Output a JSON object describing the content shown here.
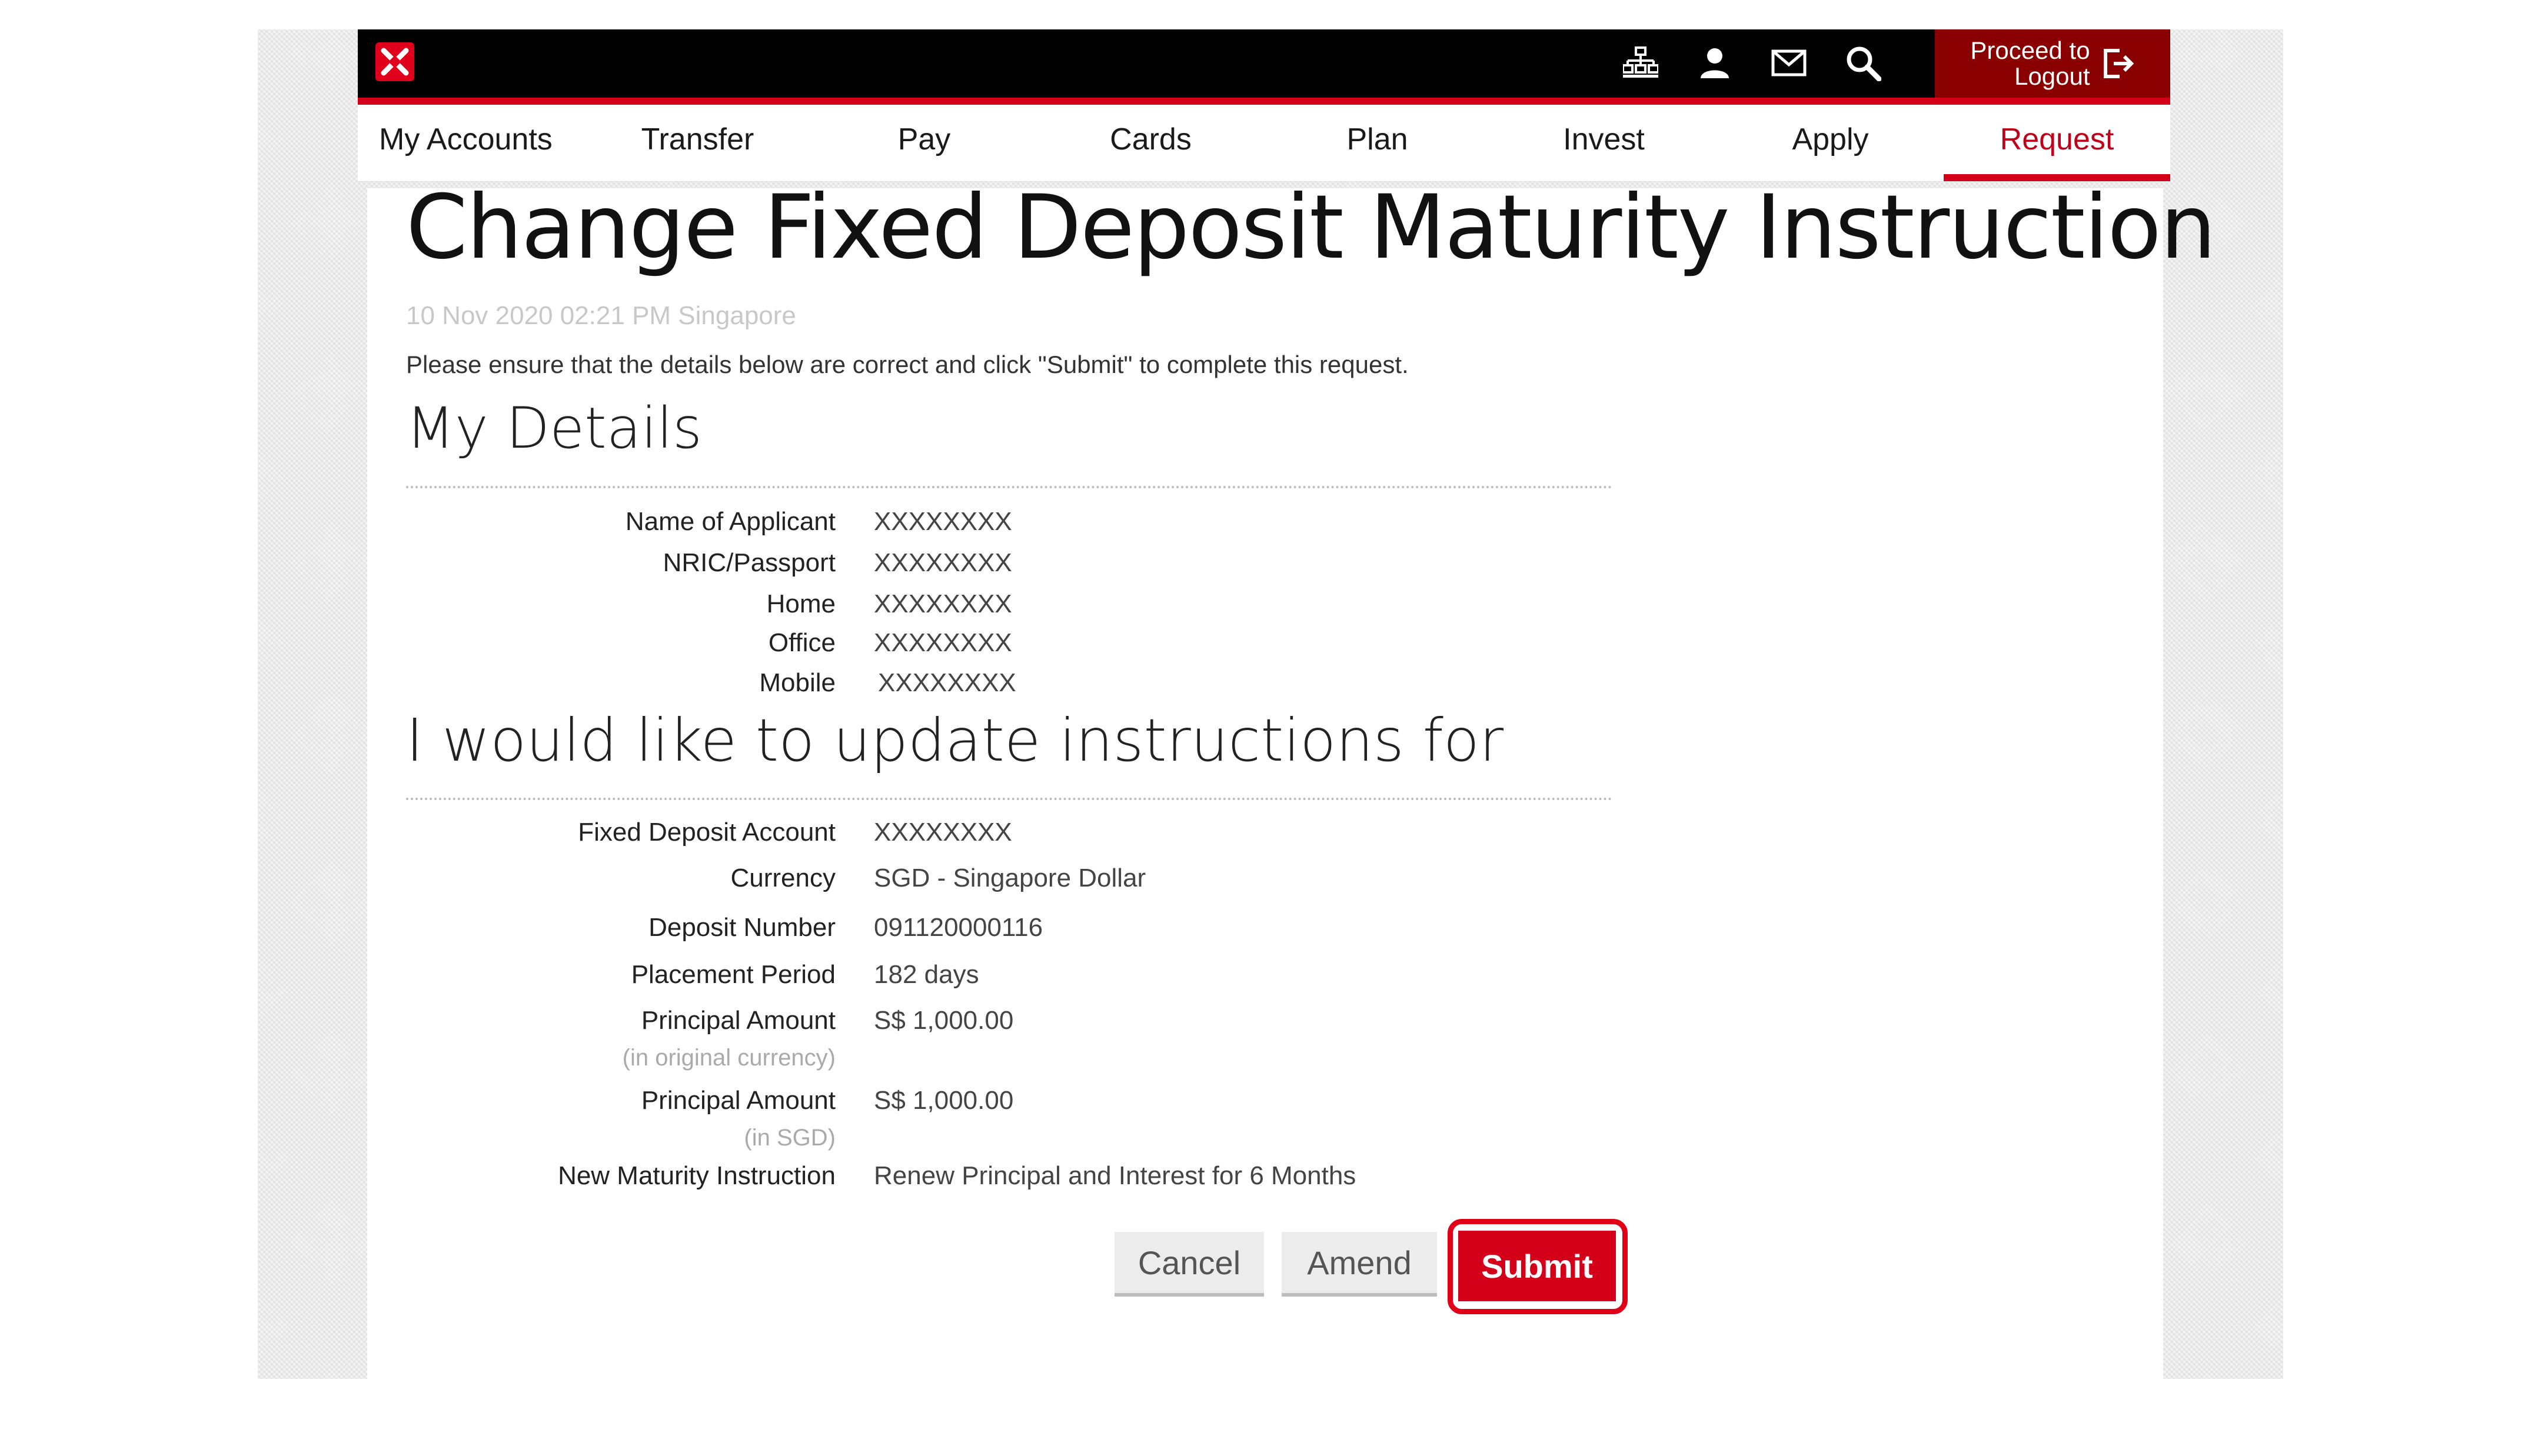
{
  "header": {
    "logout_line1": "Proceed to",
    "logout_line2": "Logout",
    "icons": [
      "sitemap-icon",
      "user-icon",
      "mail-icon",
      "search-icon",
      "logout-icon"
    ],
    "brand_color": "#d4001a"
  },
  "nav": {
    "items": [
      "My Accounts",
      "Transfer",
      "Pay",
      "Cards",
      "Plan",
      "Invest",
      "Apply",
      "Request"
    ],
    "active": "Request"
  },
  "page": {
    "title": "Change Fixed Deposit Maturity Instruction",
    "timestamp": "10 Nov 2020 02:21 PM Singapore",
    "instruction": "Please ensure that the details below are correct and click \"Submit\" to complete this request."
  },
  "my_details": {
    "heading": "My Details",
    "rows": [
      {
        "label": "Name of Applicant",
        "value": "XXXXXXXX"
      },
      {
        "label": "NRIC/Passport",
        "value": "XXXXXXXX"
      },
      {
        "label": "Home",
        "value": "XXXXXXXX"
      },
      {
        "label": "Office",
        "value": "XXXXXXXX"
      },
      {
        "label": "Mobile",
        "value": "XXXXXXXX"
      }
    ]
  },
  "update": {
    "heading": "I would like to update instructions for",
    "rows": [
      {
        "label": "Fixed Deposit Account",
        "value": "XXXXXXXX"
      },
      {
        "label": "Currency",
        "value": "SGD - Singapore Dollar"
      },
      {
        "label": "Deposit Number",
        "value": "091120000116"
      },
      {
        "label": "Placement Period",
        "value": "182 days"
      },
      {
        "label": "Principal Amount",
        "sublabel": "(in original currency)",
        "value": "S$ 1,000.00"
      },
      {
        "label": "Principal Amount",
        "sublabel": "(in SGD)",
        "value": "S$ 1,000.00"
      },
      {
        "label": "New Maturity Instruction",
        "value": "Renew Principal and Interest for 6 Months"
      }
    ]
  },
  "actions": {
    "cancel": "Cancel",
    "amend": "Amend",
    "submit": "Submit"
  }
}
